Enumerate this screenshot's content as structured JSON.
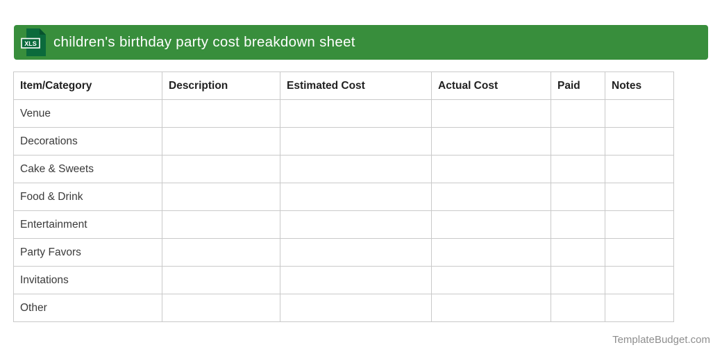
{
  "header": {
    "title": "children's birthday party cost breakdown sheet",
    "file_badge": "XLS"
  },
  "table": {
    "columns": [
      "Item/Category",
      "Description",
      "Estimated Cost",
      "Actual Cost",
      "Paid",
      "Notes"
    ],
    "rows": [
      "Venue",
      "Decorations",
      "Cake & Sweets",
      "Food & Drink",
      "Entertainment",
      "Party Favors",
      "Invitations",
      "Other"
    ]
  },
  "footer": {
    "credit": "TemplateBudget.com"
  },
  "colors": {
    "header_bar_green": "#388e3c",
    "icon_dark_green": "#0b6a3c",
    "icon_fold_green": "#07522e",
    "table_border": "#c9c9c9",
    "header_text": "#ffffff",
    "column_header_text": "#212121",
    "row_text": "#3a3a3a",
    "footer_text": "#8e8e8e"
  }
}
